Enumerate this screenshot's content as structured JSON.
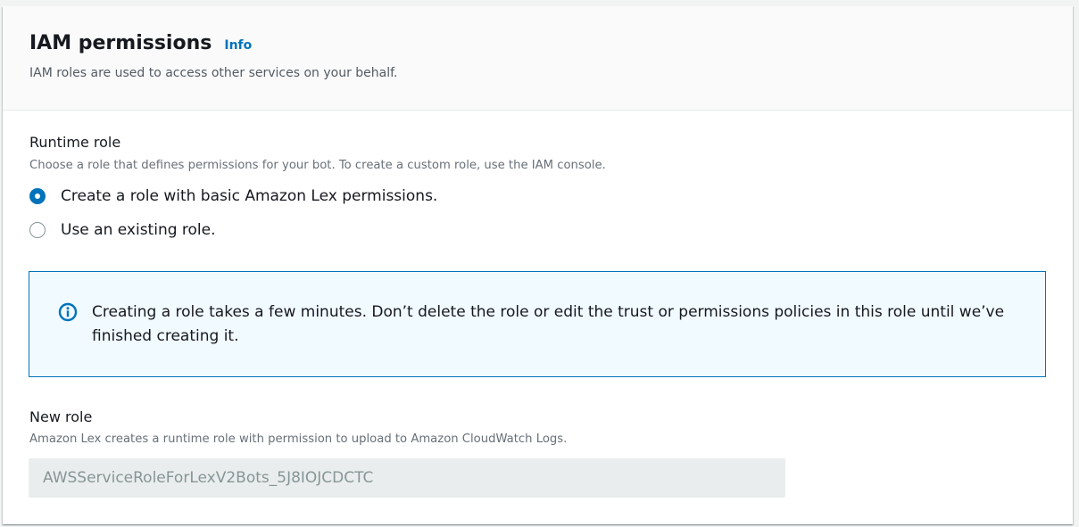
{
  "header": {
    "title": "IAM permissions",
    "info_label": "Info",
    "description": "IAM roles are used to access other services on your behalf."
  },
  "runtime_role": {
    "label": "Runtime role",
    "description": "Choose a role that defines permissions for your bot. To create a custom role, use the IAM console.",
    "options": [
      {
        "label": "Create a role with basic Amazon Lex permissions.",
        "selected": true
      },
      {
        "label": "Use an existing role.",
        "selected": false
      }
    ]
  },
  "alert": {
    "icon": "info-circle-icon",
    "text": "Creating a role takes a few minutes. Don’t delete the role or edit the trust or permissions policies in this role until we’ve finished creating it."
  },
  "new_role": {
    "label": "New role",
    "description": "Amazon Lex creates a runtime role with permission to upload to Amazon CloudWatch Logs.",
    "value": "AWSServiceRoleForLexV2Bots_5J8IOJCDCTC"
  },
  "colors": {
    "accent": "#0073bb",
    "alert_background": "#f1faff",
    "disabled_input": "#eaeded"
  }
}
